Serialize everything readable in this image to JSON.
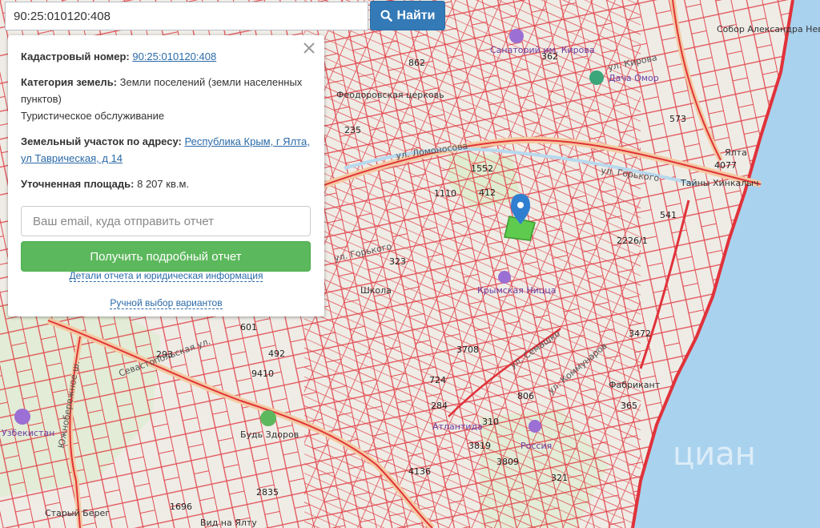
{
  "search": {
    "value": "90:25:010120:408",
    "button_label": "Найти"
  },
  "panel": {
    "cadastral_label": "Кадастровый номер:",
    "cadastral_value": "90:25:010120:408",
    "category_label": "Категория земель:",
    "category_value": "Земли поселений (земли населенных пунктов)",
    "usage": "Туристическое обслуживание",
    "address_label": "Земельный участок по адресу:",
    "address_value": "Республика Крым, г Ялта, ул Таврическая, д 14",
    "area_label": "Уточненная площадь:",
    "area_value": "8 207 кв.м.",
    "email_placeholder": "Ваш email, куда отправить отчет",
    "get_report_label": "Получить подробный отчет",
    "details_link": "Детали отчета и юридическая информация",
    "manual_link": "Ручной выбор вариантов"
  },
  "map": {
    "labels": {
      "sanatorium": "Санаторий им. Кирова",
      "kirova": "ул. Кирова",
      "dacha": "Дача Омор",
      "church": "Феодоровская церковь",
      "lomonosova": "ул. Ломоносова",
      "gorkogo": "ул. Горького",
      "gorkogo2": "ул. Горького",
      "talisman": "Тайны Хинкалыч",
      "yalta_hotel": "Ялта",
      "shkola": "Школа",
      "krymskaya": "Крымская Ницца",
      "semashko": "ул. Семашко",
      "kommunarov": "ул. Коммунаров",
      "fabrikant": "Фабрикант",
      "bud_zdorov": "Будь Здоров",
      "atlantida": "Атлантида",
      "rossiya": "Россия",
      "uzbekistan": "Узбекистан",
      "starny_bereg": "Старый Берег",
      "vid_na_yaltu": "Вид на Ялту",
      "sevastopolskaya": "Севастопольская ул.",
      "yuzhnoberezh": "Южнобережное ш.",
      "church_alexander": "Собор Александра Невского",
      "watermark": "циан"
    },
    "numbers": [
      "862",
      "362",
      "573",
      "235",
      "4077",
      "1552",
      "1110",
      "412",
      "2226/1",
      "541",
      "323",
      "3472",
      "601",
      "492",
      "293",
      "9410",
      "3708",
      "724",
      "284",
      "806",
      "365",
      "310",
      "3819",
      "3809",
      "4136",
      "321",
      "1696",
      "2835"
    ]
  },
  "colors": {
    "parcel_lines": "#e0323a",
    "sea": "#a9d2ee",
    "marker": "#2f7fd1",
    "highlight": "#5ecb4f",
    "button_blue": "#337ab7",
    "button_green": "#5cb85c"
  }
}
